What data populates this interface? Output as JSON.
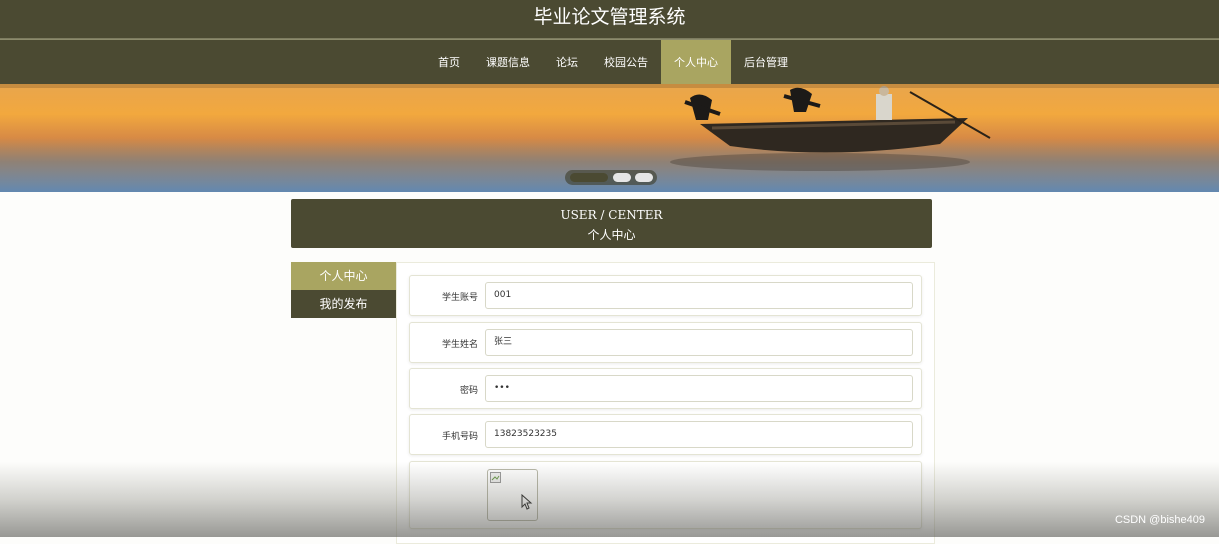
{
  "site_title": "毕业论文管理系统",
  "nav": {
    "items": [
      {
        "label": "首页"
      },
      {
        "label": "课题信息"
      },
      {
        "label": "论坛"
      },
      {
        "label": "校园公告"
      },
      {
        "label": "个人中心",
        "active": true
      },
      {
        "label": "后台管理"
      }
    ]
  },
  "banner": {
    "slide_count": 3,
    "active_slide": 1
  },
  "section_header": {
    "en": "USER / CENTER",
    "cn": "个人中心"
  },
  "side_menu": {
    "items": [
      {
        "label": "个人中心",
        "active": true
      },
      {
        "label": "我的发布"
      }
    ]
  },
  "form": {
    "student_account": {
      "label": "学生账号",
      "value": "001"
    },
    "student_name": {
      "label": "学生姓名",
      "value": "张三"
    },
    "password": {
      "label": "密码",
      "value": "•••"
    },
    "phone": {
      "label": "手机号码",
      "value": "13823523235"
    }
  },
  "colors": {
    "brand_dark": "#4b4a32",
    "brand_accent": "#a9a561"
  },
  "watermark": "CSDN @bishe409"
}
